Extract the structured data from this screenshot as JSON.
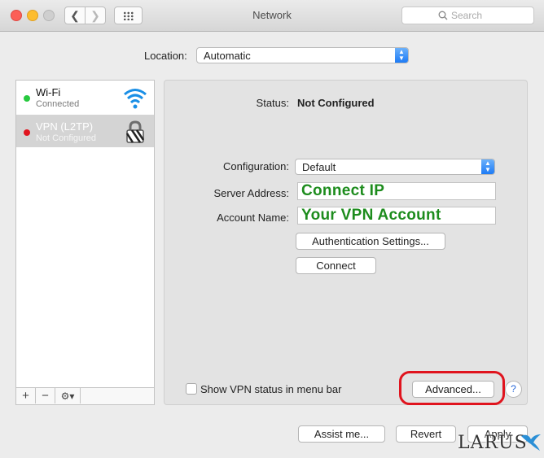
{
  "window": {
    "title": "Network"
  },
  "search": {
    "placeholder": "Search"
  },
  "location": {
    "label": "Location:",
    "value": "Automatic"
  },
  "sidebar": {
    "services": [
      {
        "name": "Wi-Fi",
        "status": "Connected",
        "dot_color": "#27c93f",
        "icon": "wifi-icon"
      },
      {
        "name": "VPN (L2TP)",
        "status": "Not Configured",
        "dot_color": "#e0141e",
        "icon": "lock-icon"
      }
    ],
    "toolbar": {
      "add": "+",
      "remove": "−",
      "gear": "⚙▾"
    }
  },
  "panel": {
    "status_label": "Status:",
    "status_value": "Not Configured",
    "configuration_label": "Configuration:",
    "configuration_value": "Default",
    "server_label": "Server Address:",
    "server_value": "Connect IP",
    "account_label": "Account Name:",
    "account_value": "Your VPN Account",
    "auth_button": "Authentication Settings...",
    "connect_button": "Connect",
    "show_status_label": "Show VPN status in menu bar",
    "advanced_button": "Advanced...",
    "help": "?"
  },
  "footer": {
    "assist_button": "Assist me...",
    "revert_button": "Revert",
    "apply_button": "Apply"
  },
  "watermark": {
    "text": "LARUS"
  },
  "colors": {
    "annotation_red": "#e0141e",
    "annotation_green": "#1d8c1d",
    "accent_blue": "#1d7bf5"
  }
}
